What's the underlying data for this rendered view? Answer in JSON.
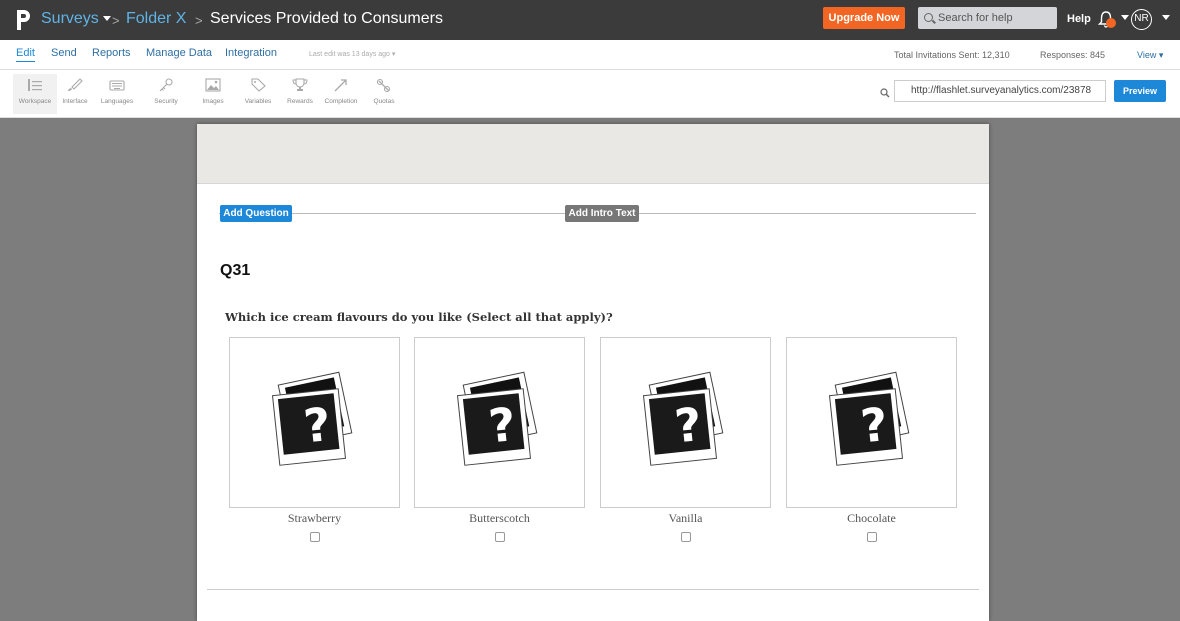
{
  "topbar": {
    "crumbs": [
      "Surveys",
      "Folder X",
      "Services Provided to Consumers"
    ],
    "upgrade_label": "Upgrade Now",
    "search_placeholder": "Search for help",
    "help_label": "Help",
    "avatar_initials": "NR",
    "accent_color": "#f26522"
  },
  "subnav": {
    "tabs": [
      "Edit",
      "Send",
      "Reports",
      "Manage Data",
      "Integration"
    ],
    "active_tab": "Edit",
    "last_edit": "Last edit was 13 days ago",
    "invitations": "Total Invitations Sent: 12,310",
    "responses": "Responses: 845",
    "view": "View"
  },
  "toolbar": {
    "tools": [
      {
        "label": "Workspace",
        "icon": "list-icon"
      },
      {
        "label": "Interface",
        "icon": "brush-icon"
      },
      {
        "label": "Languages",
        "icon": "keyboard-icon"
      },
      {
        "label": "Security",
        "icon": "key-icon"
      },
      {
        "label": "Images",
        "icon": "image-icon"
      },
      {
        "label": "Variables",
        "icon": "tag-icon"
      },
      {
        "label": "Rewards",
        "icon": "trophy-icon"
      },
      {
        "label": "Completion",
        "icon": "arrow-icon"
      },
      {
        "label": "Quotas",
        "icon": "quota-icon"
      }
    ],
    "url": "http://flashlet.surveyanalytics.com/23878",
    "preview_label": "Preview"
  },
  "survey": {
    "add_question_label": "Add Question",
    "add_intro_label": "Add Intro Text",
    "question_number": "Q31",
    "question_text": "Which ice cream flavours do you like (Select all that apply)?",
    "options": [
      "Strawberry",
      "Butterscotch",
      "Vanilla",
      "Chocolate"
    ]
  }
}
